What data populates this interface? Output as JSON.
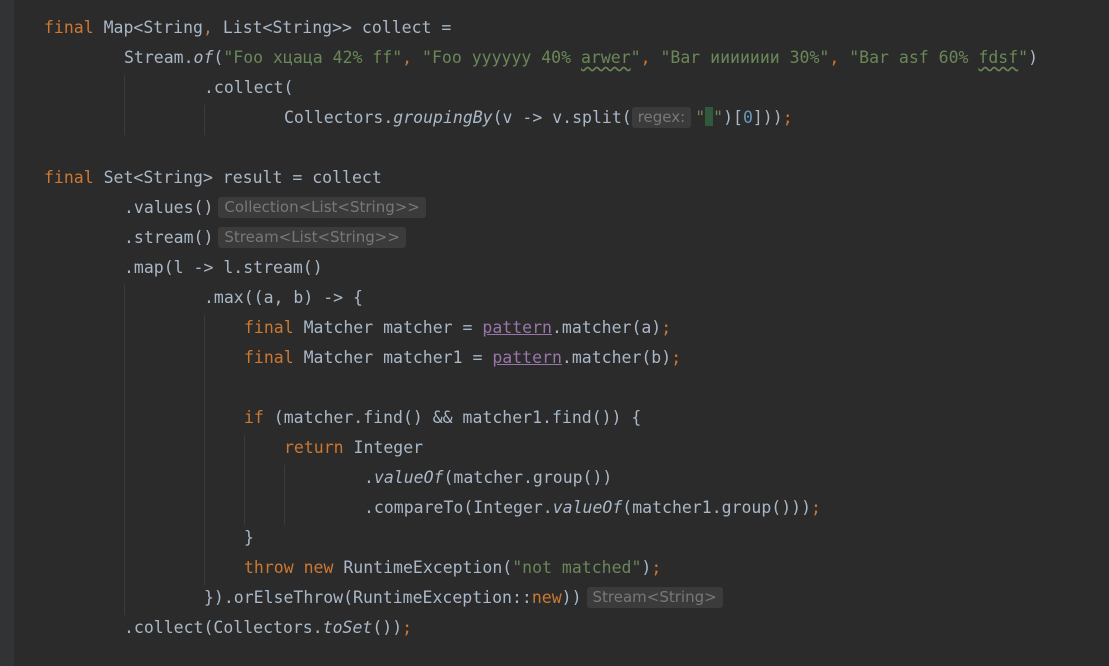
{
  "code": {
    "l1": {
      "kw_final": "final",
      "t1": " Map<String",
      "comma": ",",
      "t2": " List<String>> collect ="
    },
    "l2": {
      "t1": "Stream.",
      "of": "of",
      "paren": "(",
      "s1": "\"Foo хцаца 42% ff\"",
      "sep1": ", ",
      "s2a": "\"Foo yyyyyy 40% ",
      "s2b": "arwer",
      "s2c": "\"",
      "sep2": ", ",
      "s3": "\"Bar иииииии 30%\"",
      "sep3": ", ",
      "s4a": "\"Bar asf 60% ",
      "s4b": "fdsf",
      "s4c": "\"",
      "close": ")"
    },
    "l3": {
      "t": ".collect("
    },
    "l4": {
      "t1": "Collectors.",
      "grouping": "groupingBy",
      "t2": "(v -> v.split(",
      "hint": "regex:",
      "q1": "\"",
      "q2": "\"",
      "t3": ")[",
      "num": "0",
      "t4": "]))",
      "semi": ";"
    },
    "l5": {
      "kw_final": "final",
      "t": " Set<String> result = collect"
    },
    "l6": {
      "t": ".values()",
      "hint": "Collection<List<String>>"
    },
    "l7": {
      "t": ".stream()",
      "hint": "Stream<List<String>>"
    },
    "l8": {
      "t": ".map(l -> l.stream()"
    },
    "l9": {
      "t": ".max((a, b) -> {"
    },
    "l10": {
      "kw_final": "final",
      "t1": " Matcher matcher = ",
      "field": "pattern",
      "t2": ".matcher(a)",
      "semi": ";"
    },
    "l11": {
      "kw_final": "final",
      "t1": " Matcher matcher1 = ",
      "field": "pattern",
      "t2": ".matcher(b)",
      "semi": ";"
    },
    "l12": {
      "kw_if": "if",
      "t": " (matcher.find() && matcher1.find()) {"
    },
    "l13": {
      "kw_return": "return",
      "t": " Integer"
    },
    "l14": {
      "t1": ".",
      "valueOf": "valueOf",
      "t2": "(matcher.group())"
    },
    "l15": {
      "t1": ".compareTo(Integer.",
      "valueOf": "valueOf",
      "t2": "(matcher1.group()))",
      "semi": ";"
    },
    "l16": {
      "t": "}"
    },
    "l17": {
      "kw_throw": "throw",
      "sp": " ",
      "kw_new": "new",
      "t1": " RuntimeException(",
      "str": "\"not matched\"",
      "t2": ")",
      "semi": ";"
    },
    "l18": {
      "t1": "}).orElseThrow(RuntimeException::",
      "kw_new": "new",
      "t2": "))",
      "hint": "Stream<String>"
    },
    "l19": {
      "t1": ".collect(Collectors.",
      "toSet": "toSet",
      "t2": "())",
      "semi": ";"
    }
  },
  "colors": {
    "background": "#2b2b2b",
    "default_text": "#a9b7c6",
    "keyword": "#cc7832",
    "string": "#6a8759",
    "number": "#6897bb",
    "field": "#9876aa",
    "hint_bg": "#3b3b3b",
    "hint_text": "#787878"
  }
}
